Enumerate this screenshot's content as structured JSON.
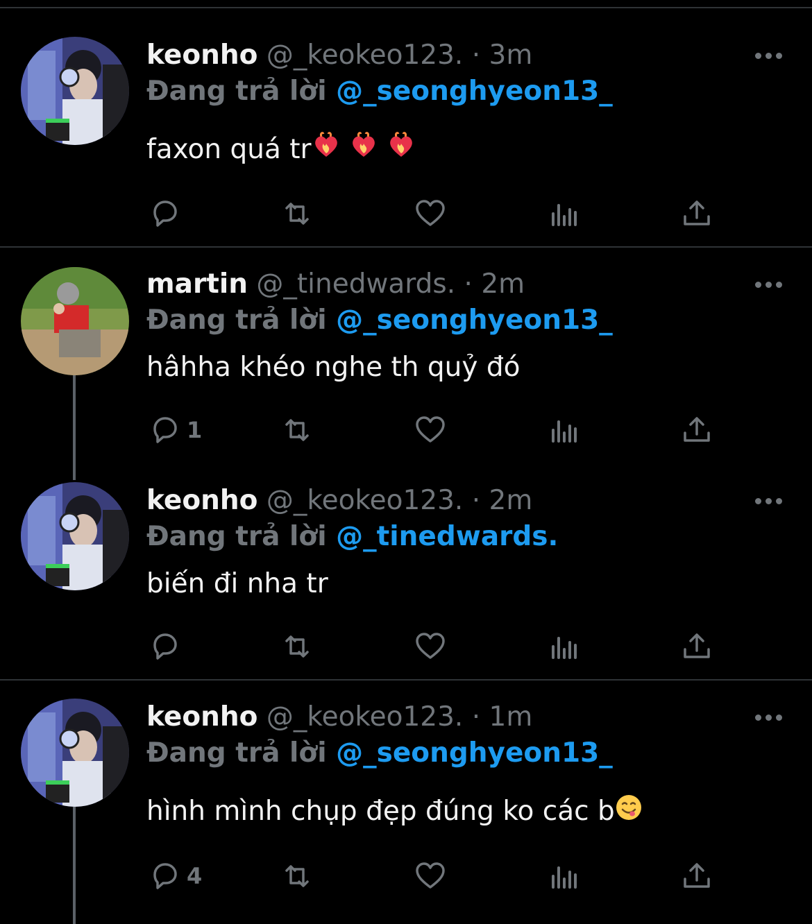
{
  "colors": {
    "background": "#000000",
    "text": "#e7e9ea",
    "secondary": "#71767b",
    "link": "#1d9bf0",
    "divider": "#2f3336"
  },
  "reply_prefix": "Đang trả lời",
  "tweets": [
    {
      "name": "keonho",
      "handle": "@_keokeo123.",
      "dot": "·",
      "time": "3m",
      "reply_to": "@_seonghyeon13_",
      "text": "faxon quá tr",
      "emoji": [
        "heart-on-fire",
        "heart-on-fire",
        "heart-on-fire"
      ],
      "reply_count": "",
      "avatar": "keonho-avatar"
    },
    {
      "name": "martin",
      "handle": "@_tinedwards.",
      "dot": "·",
      "time": "2m",
      "reply_to": "@_seonghyeon13_",
      "text": "hâhha khéo nghe th quỷ đó",
      "emoji": [],
      "reply_count": "1",
      "avatar": "martin-avatar"
    },
    {
      "name": "keonho",
      "handle": "@_keokeo123.",
      "dot": "·",
      "time": "2m",
      "reply_to": "@_tinedwards.",
      "text": "biến đi nha tr",
      "emoji": [],
      "reply_count": "",
      "avatar": "keonho-avatar"
    },
    {
      "name": "keonho",
      "handle": "@_keokeo123.",
      "dot": "·",
      "time": "1m",
      "reply_to": "@_seonghyeon13_",
      "text": "hình mình chụp đẹp đúng ko các b",
      "emoji": [
        "yum-face"
      ],
      "reply_count": "4",
      "avatar": "keonho-avatar"
    }
  ]
}
